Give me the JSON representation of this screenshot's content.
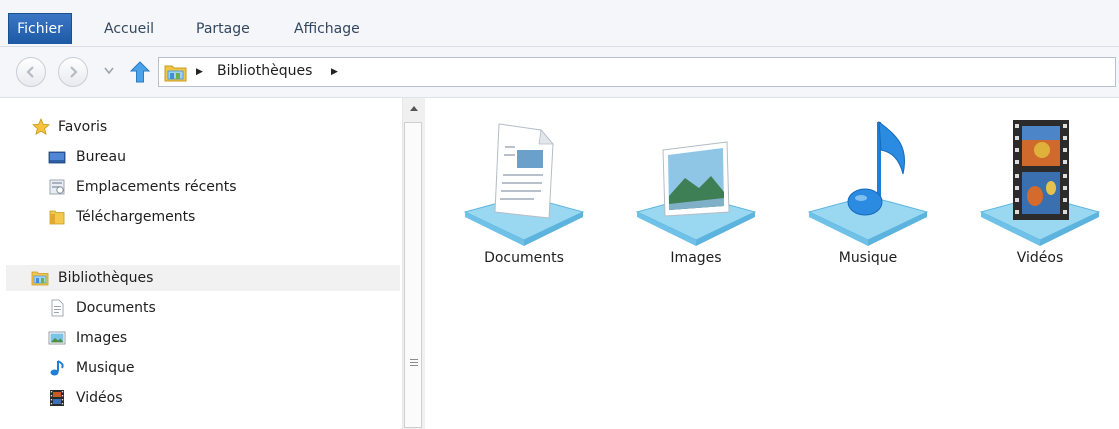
{
  "ribbon": {
    "tabs": [
      {
        "label": "Fichier"
      },
      {
        "label": "Accueil"
      },
      {
        "label": "Partage"
      },
      {
        "label": "Affichage"
      }
    ]
  },
  "address_bar": {
    "breadcrumb": "Bibliothèques"
  },
  "nav_pane": {
    "favorites": {
      "label": "Favoris",
      "items": [
        {
          "label": "Bureau",
          "icon": "desktop-icon"
        },
        {
          "label": "Emplacements récents",
          "icon": "recent-places-icon"
        },
        {
          "label": "Téléchargements",
          "icon": "downloads-folder-icon"
        }
      ]
    },
    "libraries": {
      "label": "Bibliothèques",
      "items": [
        {
          "label": "Documents",
          "icon": "documents-icon"
        },
        {
          "label": "Images",
          "icon": "images-icon"
        },
        {
          "label": "Musique",
          "icon": "music-icon"
        },
        {
          "label": "Vidéos",
          "icon": "videos-icon"
        }
      ]
    }
  },
  "content": {
    "libraries": [
      {
        "label": "Documents",
        "icon": "documents-library-icon"
      },
      {
        "label": "Images",
        "icon": "images-library-icon"
      },
      {
        "label": "Musique",
        "icon": "music-library-icon"
      },
      {
        "label": "Vidéos",
        "icon": "videos-library-icon"
      }
    ]
  },
  "colors": {
    "file_tab": "#2563b0",
    "selection": "#f1f1f1",
    "tile_platform": "#8fd0ef"
  }
}
